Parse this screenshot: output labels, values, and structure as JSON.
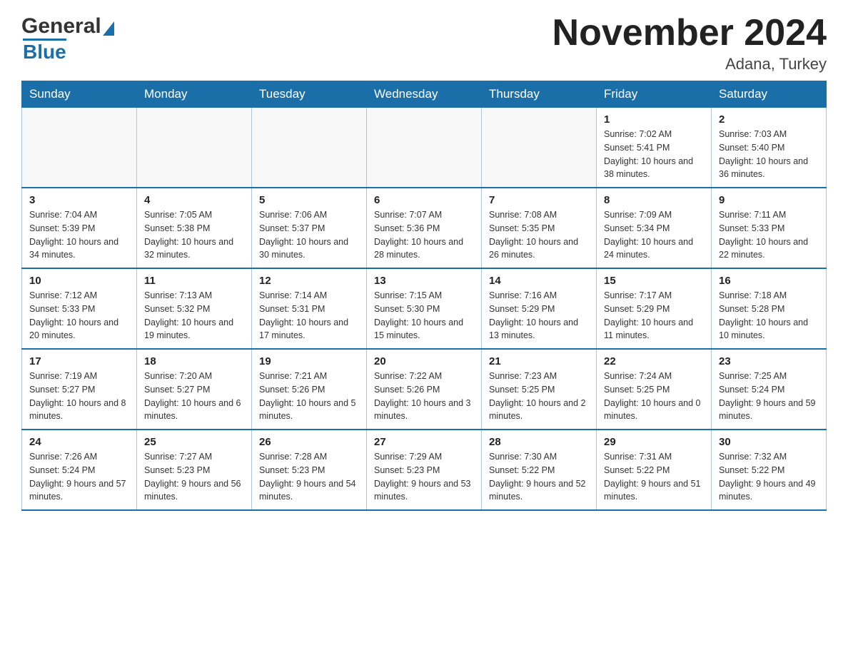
{
  "header": {
    "logo_general": "General",
    "logo_blue": "Blue",
    "month_title": "November 2024",
    "location": "Adana, Turkey"
  },
  "days_of_week": [
    "Sunday",
    "Monday",
    "Tuesday",
    "Wednesday",
    "Thursday",
    "Friday",
    "Saturday"
  ],
  "weeks": [
    [
      {
        "day": "",
        "info": ""
      },
      {
        "day": "",
        "info": ""
      },
      {
        "day": "",
        "info": ""
      },
      {
        "day": "",
        "info": ""
      },
      {
        "day": "",
        "info": ""
      },
      {
        "day": "1",
        "info": "Sunrise: 7:02 AM\nSunset: 5:41 PM\nDaylight: 10 hours and 38 minutes."
      },
      {
        "day": "2",
        "info": "Sunrise: 7:03 AM\nSunset: 5:40 PM\nDaylight: 10 hours and 36 minutes."
      }
    ],
    [
      {
        "day": "3",
        "info": "Sunrise: 7:04 AM\nSunset: 5:39 PM\nDaylight: 10 hours and 34 minutes."
      },
      {
        "day": "4",
        "info": "Sunrise: 7:05 AM\nSunset: 5:38 PM\nDaylight: 10 hours and 32 minutes."
      },
      {
        "day": "5",
        "info": "Sunrise: 7:06 AM\nSunset: 5:37 PM\nDaylight: 10 hours and 30 minutes."
      },
      {
        "day": "6",
        "info": "Sunrise: 7:07 AM\nSunset: 5:36 PM\nDaylight: 10 hours and 28 minutes."
      },
      {
        "day": "7",
        "info": "Sunrise: 7:08 AM\nSunset: 5:35 PM\nDaylight: 10 hours and 26 minutes."
      },
      {
        "day": "8",
        "info": "Sunrise: 7:09 AM\nSunset: 5:34 PM\nDaylight: 10 hours and 24 minutes."
      },
      {
        "day": "9",
        "info": "Sunrise: 7:11 AM\nSunset: 5:33 PM\nDaylight: 10 hours and 22 minutes."
      }
    ],
    [
      {
        "day": "10",
        "info": "Sunrise: 7:12 AM\nSunset: 5:33 PM\nDaylight: 10 hours and 20 minutes."
      },
      {
        "day": "11",
        "info": "Sunrise: 7:13 AM\nSunset: 5:32 PM\nDaylight: 10 hours and 19 minutes."
      },
      {
        "day": "12",
        "info": "Sunrise: 7:14 AM\nSunset: 5:31 PM\nDaylight: 10 hours and 17 minutes."
      },
      {
        "day": "13",
        "info": "Sunrise: 7:15 AM\nSunset: 5:30 PM\nDaylight: 10 hours and 15 minutes."
      },
      {
        "day": "14",
        "info": "Sunrise: 7:16 AM\nSunset: 5:29 PM\nDaylight: 10 hours and 13 minutes."
      },
      {
        "day": "15",
        "info": "Sunrise: 7:17 AM\nSunset: 5:29 PM\nDaylight: 10 hours and 11 minutes."
      },
      {
        "day": "16",
        "info": "Sunrise: 7:18 AM\nSunset: 5:28 PM\nDaylight: 10 hours and 10 minutes."
      }
    ],
    [
      {
        "day": "17",
        "info": "Sunrise: 7:19 AM\nSunset: 5:27 PM\nDaylight: 10 hours and 8 minutes."
      },
      {
        "day": "18",
        "info": "Sunrise: 7:20 AM\nSunset: 5:27 PM\nDaylight: 10 hours and 6 minutes."
      },
      {
        "day": "19",
        "info": "Sunrise: 7:21 AM\nSunset: 5:26 PM\nDaylight: 10 hours and 5 minutes."
      },
      {
        "day": "20",
        "info": "Sunrise: 7:22 AM\nSunset: 5:26 PM\nDaylight: 10 hours and 3 minutes."
      },
      {
        "day": "21",
        "info": "Sunrise: 7:23 AM\nSunset: 5:25 PM\nDaylight: 10 hours and 2 minutes."
      },
      {
        "day": "22",
        "info": "Sunrise: 7:24 AM\nSunset: 5:25 PM\nDaylight: 10 hours and 0 minutes."
      },
      {
        "day": "23",
        "info": "Sunrise: 7:25 AM\nSunset: 5:24 PM\nDaylight: 9 hours and 59 minutes."
      }
    ],
    [
      {
        "day": "24",
        "info": "Sunrise: 7:26 AM\nSunset: 5:24 PM\nDaylight: 9 hours and 57 minutes."
      },
      {
        "day": "25",
        "info": "Sunrise: 7:27 AM\nSunset: 5:23 PM\nDaylight: 9 hours and 56 minutes."
      },
      {
        "day": "26",
        "info": "Sunrise: 7:28 AM\nSunset: 5:23 PM\nDaylight: 9 hours and 54 minutes."
      },
      {
        "day": "27",
        "info": "Sunrise: 7:29 AM\nSunset: 5:23 PM\nDaylight: 9 hours and 53 minutes."
      },
      {
        "day": "28",
        "info": "Sunrise: 7:30 AM\nSunset: 5:22 PM\nDaylight: 9 hours and 52 minutes."
      },
      {
        "day": "29",
        "info": "Sunrise: 7:31 AM\nSunset: 5:22 PM\nDaylight: 9 hours and 51 minutes."
      },
      {
        "day": "30",
        "info": "Sunrise: 7:32 AM\nSunset: 5:22 PM\nDaylight: 9 hours and 49 minutes."
      }
    ]
  ]
}
